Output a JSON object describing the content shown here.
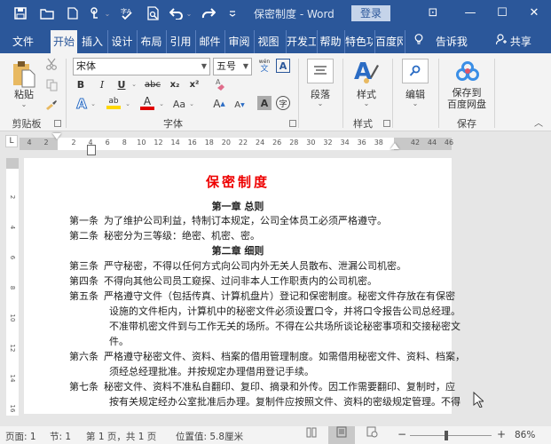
{
  "app": {
    "title": "保密制度 - Word",
    "login_label": "登录"
  },
  "quick_access": [
    {
      "name": "save-icon",
      "glyph": "💾"
    },
    {
      "name": "open-icon",
      "glyph": "📂"
    },
    {
      "name": "new-icon",
      "glyph": "🗋"
    },
    {
      "name": "touch-mode-icon",
      "glyph": "☝"
    },
    {
      "name": "spelling-icon",
      "glyph": "✓"
    },
    {
      "name": "print-preview-icon",
      "glyph": "🔍"
    },
    {
      "name": "undo-icon",
      "glyph": "↶"
    },
    {
      "name": "redo-icon",
      "glyph": "↷"
    },
    {
      "name": "customize-qa-icon",
      "glyph": "="
    }
  ],
  "window_controls": {
    "ribbon_display": "⊡",
    "minimize": "—",
    "maximize": "☐",
    "close": "✕"
  },
  "tabs": [
    "文件",
    "开始",
    "插入",
    "设计",
    "布局",
    "引用",
    "邮件",
    "审阅",
    "视图",
    "开发工",
    "帮助",
    "特色功",
    "百度网"
  ],
  "active_tab": "开始",
  "tell_me": {
    "icon": "lightbulb-icon",
    "label": "告诉我"
  },
  "share": {
    "icon": "person-icon",
    "label": "共享"
  },
  "ribbon": {
    "clipboard": {
      "paste_label": "粘贴",
      "group_label": "剪贴板"
    },
    "font": {
      "font_name": "宋体",
      "font_size": "五号",
      "bold": "B",
      "italic": "I",
      "underline": "U",
      "strikethrough": "abc",
      "subscript": "x₂",
      "superscript": "x²",
      "text_effects": "A",
      "highlight": "ab",
      "font_color": "A",
      "change_case": "Aa",
      "grow_font": "A",
      "shrink_font": "A",
      "char_shading": "A",
      "enclose_char": "字",
      "phonetic": "文",
      "phonetic_top": "wén",
      "char_border": "A",
      "group_label": "字体",
      "highlight_color": "#ffd700",
      "font_color_value": "#e00000"
    },
    "paragraph": {
      "label": "段落"
    },
    "styles": {
      "label": "样式",
      "group_label": "样式"
    },
    "editing": {
      "label": "编辑"
    },
    "save_baidu": {
      "label_line1": "保存到",
      "label_line2": "百度网盘",
      "group_label": "保存"
    }
  },
  "ruler": {
    "corner": "L",
    "left_ticks": [
      "4",
      "2"
    ],
    "ticks": [
      "2",
      "4",
      "6",
      "8",
      "10",
      "12",
      "14",
      "16",
      "18",
      "20",
      "22",
      "24",
      "26",
      "28",
      "30",
      "32",
      "34",
      "36",
      "38"
    ],
    "right_ticks": [
      "42",
      "44",
      "46"
    ],
    "vertical_ticks": [
      "2",
      "4",
      "6",
      "8",
      "10",
      "12",
      "14",
      "16"
    ]
  },
  "document": {
    "title": "保密制度",
    "chapter1": "第一章 总则",
    "chapter2": "第二章 细则",
    "articles": [
      {
        "label": "第一条",
        "lines": [
          "为了维护公司利益，特制订本规定，公司全体员工必须严格遵守。"
        ]
      },
      {
        "label": "第二条",
        "lines": [
          "秘密分为三等级：绝密、机密、密。"
        ]
      },
      {
        "label": "第三条",
        "lines": [
          "严守秘密，不得以任何方式向公司内外无关人员散布、泄漏公司机密。"
        ]
      },
      {
        "label": "第四条",
        "lines": [
          "不得向其他公司员工窥探、过问非本人工作职责内的公司机密。"
        ]
      },
      {
        "label": "第五条",
        "lines": [
          "严格遵守文件（包括传真、计算机盘片）登记和保密制度。秘密文件存放在有保密",
          "设施的文件柜内，计算机中的秘密文件必须设置口令，并将口令报告公司总经理。",
          "不准带机密文件到与工作无关的场所。不得在公共场所谈论秘密事项和交接秘密文",
          "件。"
        ]
      },
      {
        "label": "第六条",
        "lines": [
          "严格遵守秘密文件、资料、档案的借用管理制度。如需借用秘密文件、资料、档案，",
          "须经总经理批准。并按规定办理借用登记手续。"
        ]
      },
      {
        "label": "第七条",
        "lines": [
          "秘密文件、资料不准私自翻印、复印、摘录和外传。因工作需要翻印、复制时，应",
          "按有关规定经办公室批准后办理。复制件应按照文件、资料的密级规定管理。不得"
        ]
      }
    ]
  },
  "status": {
    "page": "页面: 1",
    "section": "节: 1",
    "page_count": "第 1 页，共 1 页",
    "position": "位置值: 5.8厘米",
    "zoom_minus": "−",
    "zoom_plus": "+",
    "zoom": "86%",
    "zoom_fraction": 0.45
  }
}
